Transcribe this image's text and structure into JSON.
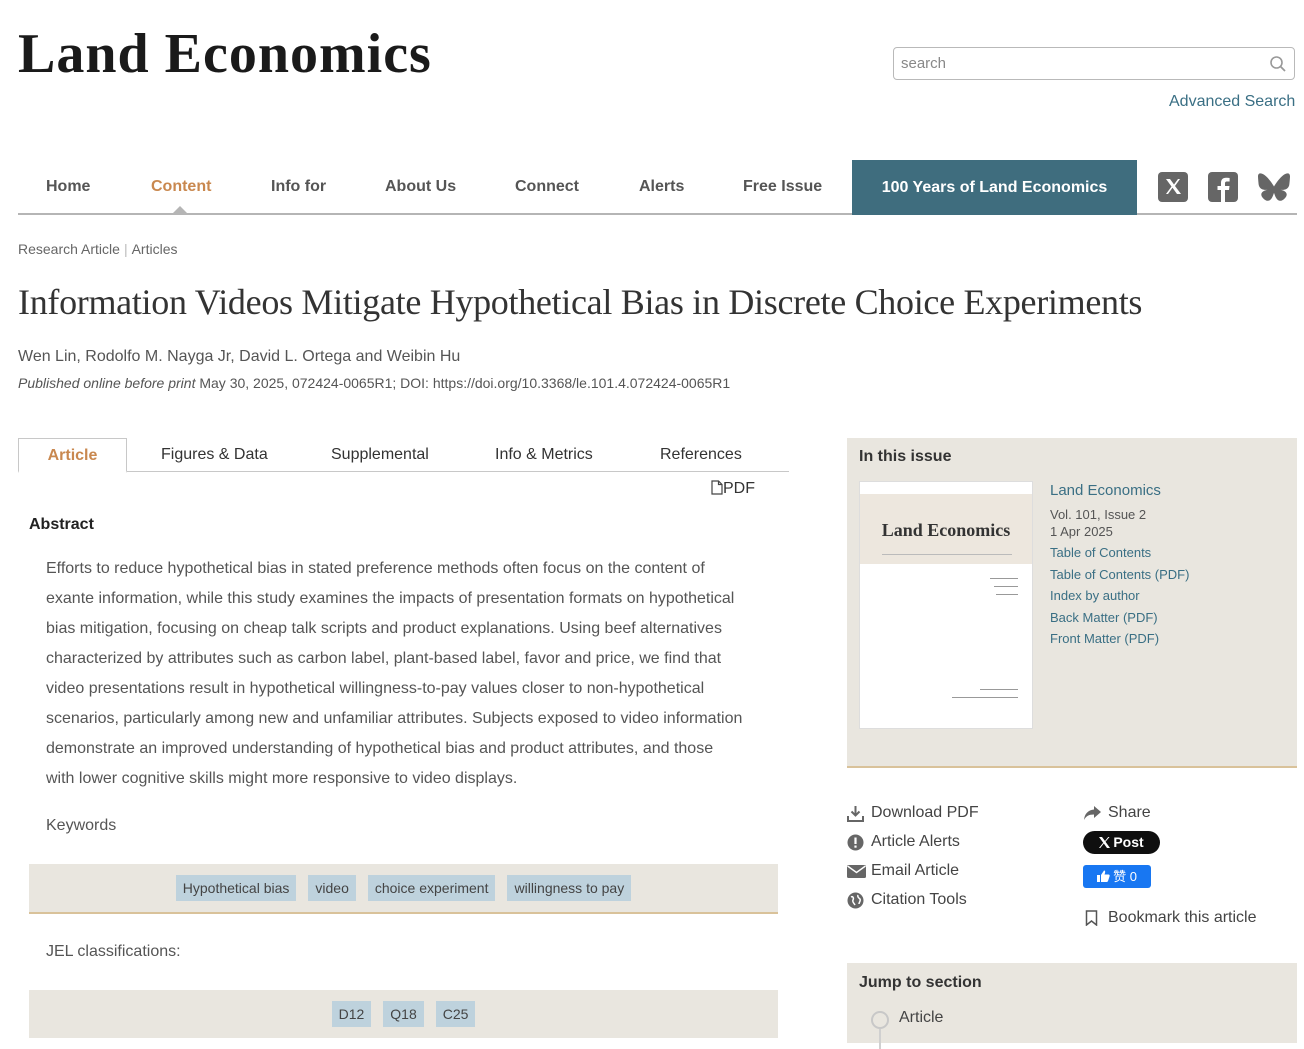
{
  "site": {
    "title": "Land Economics",
    "search_placeholder": "search",
    "advanced_search": "Advanced Search"
  },
  "nav": {
    "items": [
      "Home",
      "Content",
      "Info for",
      "About Us",
      "Connect",
      "Alerts",
      "Free Issue"
    ],
    "active": "Content",
    "feature": "100 Years of Land Economics",
    "social_icons": [
      "x-icon",
      "facebook-icon",
      "bluesky-icon"
    ]
  },
  "breadcrumb": [
    "Research Article",
    "Articles"
  ],
  "article": {
    "title": "Information Videos Mitigate Hypothetical Bias in Discrete Choice Experiments",
    "authors": "Wen Lin, Rodolfo M. Nayga Jr, David L. Ortega and Weibin Hu",
    "published_label": "Published online before print",
    "published_details": "May 30, 2025, 072424-0065R1; DOI: https://doi.org/10.3368/le.101.4.072424-0065R1"
  },
  "tabs": [
    "Article",
    "Figures & Data",
    "Supplemental",
    "Info & Metrics",
    "References"
  ],
  "pdf_label": "PDF",
  "abstract": {
    "heading": "Abstract",
    "lines": [
      "Efforts to reduce hypothetical bias in stated preference methods often focus on the content of",
      "exante information, while this study examines the impacts of presentation formats on hypothetical",
      "bias mitigation, focusing on cheap talk scripts and product explanations. Using beef alternatives",
      "characterized by attributes such as carbon label, plant-based label, favor and price, we find that",
      "video presentations result in hypothetical willingness-to-pay values closer to non-hypothetical",
      "scenarios, particularly among new and unfamiliar attributes. Subjects exposed to video information",
      "demonstrate an improved understanding of hypothetical bias and product attributes, and those",
      "with lower cognitive skills might more responsive to video displays."
    ]
  },
  "keywords": {
    "heading": "Keywords",
    "items": [
      "Hypothetical bias",
      "video",
      "choice experiment",
      "willingness to pay"
    ]
  },
  "jel": {
    "heading": "JEL classifications:",
    "items": [
      "D12",
      "Q18",
      "C25"
    ]
  },
  "issue": {
    "heading": "In this issue",
    "cover_title": "Land Economics",
    "journal": "Land Economics",
    "volume": "Vol. 101, Issue 2",
    "date": "1 Apr 2025",
    "links": [
      "Table of Contents",
      "Table of Contents (PDF)",
      "Index by author",
      "Back Matter (PDF)",
      "Front Matter (PDF)"
    ]
  },
  "tools": {
    "download": "Download PDF",
    "alerts": "Article Alerts",
    "email": "Email Article",
    "citation": "Citation Tools",
    "share": "Share",
    "post": "Post",
    "like": "赞 0",
    "bookmark": "Bookmark this article"
  },
  "jump": {
    "heading": "Jump to section",
    "items": [
      "Article"
    ]
  }
}
